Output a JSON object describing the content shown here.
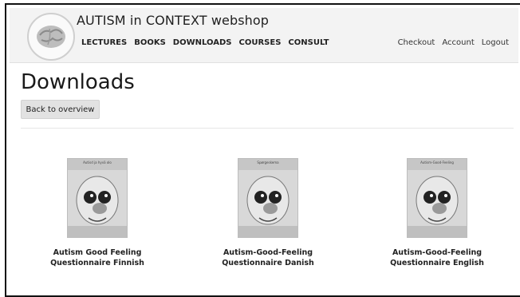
{
  "header": {
    "site_title": "AUTISM in CONTEXT webshop",
    "main_nav": [
      "LECTURES",
      "BOOKS",
      "DOWNLOADS",
      "COURSES",
      "CONSULT"
    ],
    "user_nav": [
      "Checkout",
      "Account",
      "Logout"
    ]
  },
  "page": {
    "title": "Downloads",
    "back_button_label": "Back to overview"
  },
  "products": [
    {
      "cover_heading": "Autisd ja hyvä olo",
      "title_line1": "Autism Good Feeling",
      "title_line2": "Questionnaire Finnish"
    },
    {
      "cover_heading": "Spørgeskema",
      "title_line1": "Autism-Good-Feeling",
      "title_line2": "Questionnaire Danish"
    },
    {
      "cover_heading": "Autism-Good-Feeling",
      "title_line1": "Autism-Good-Feeling",
      "title_line2": "Questionnaire English"
    }
  ],
  "icons": {
    "logo": "brain-logo-icon"
  }
}
